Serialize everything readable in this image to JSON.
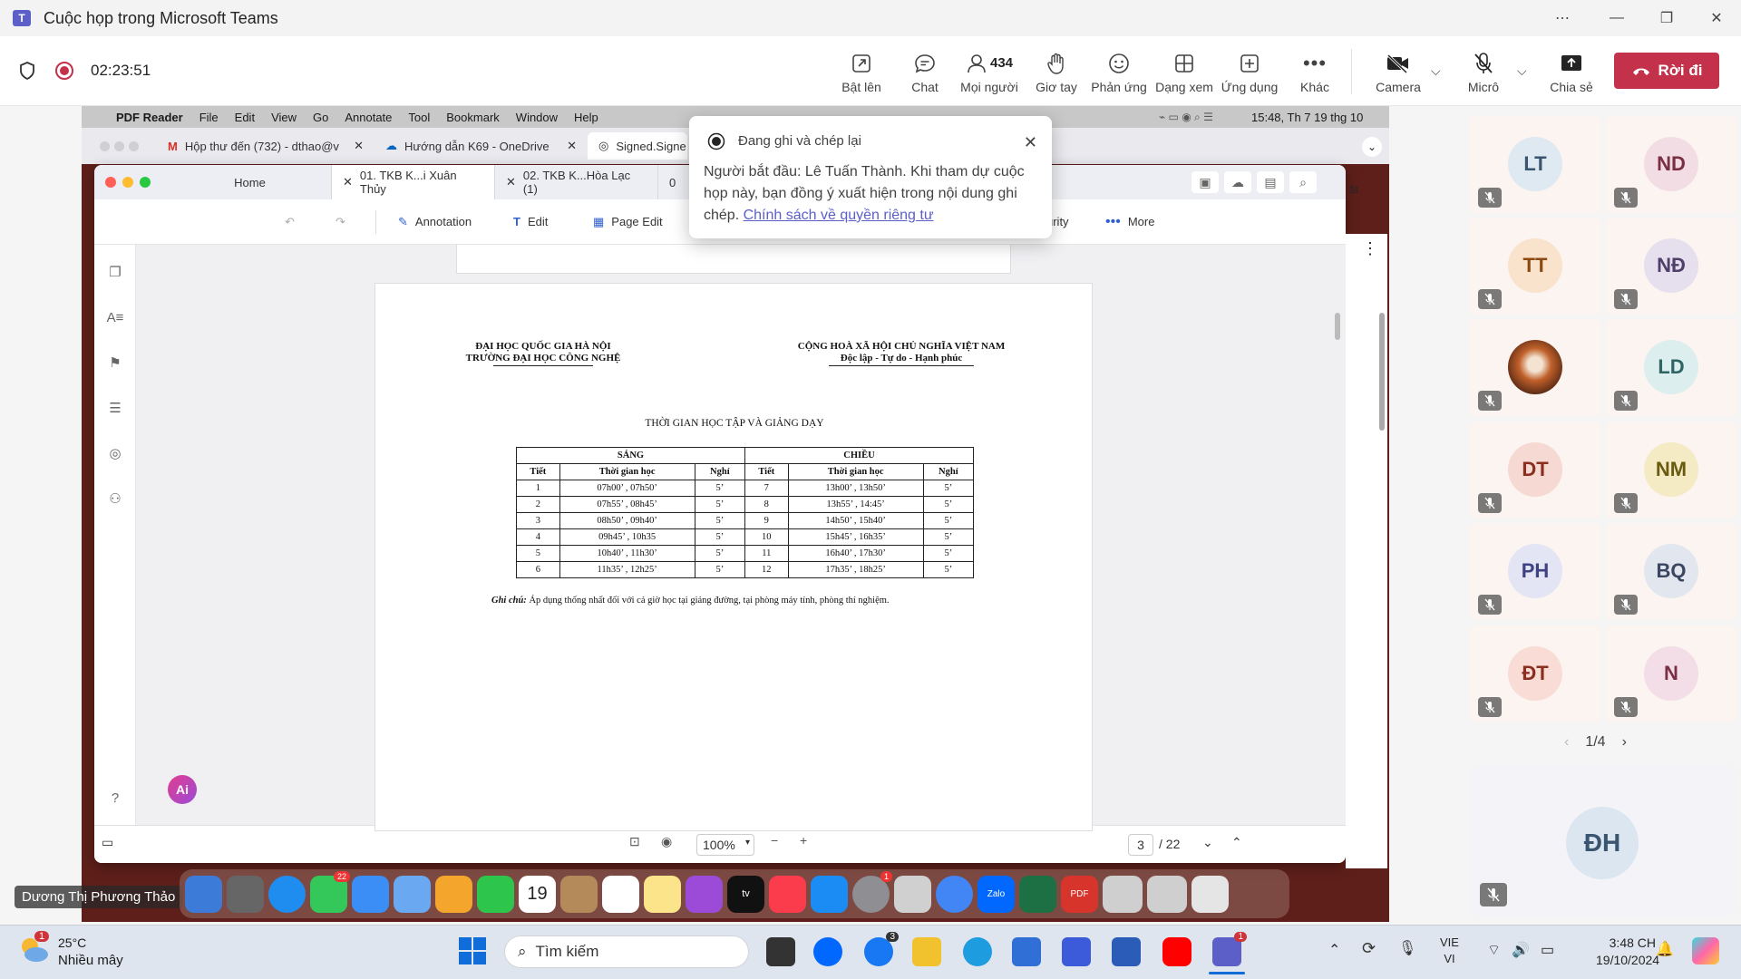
{
  "window": {
    "title": "Cuộc họp trong Microsoft Teams"
  },
  "meeting": {
    "timer": "02:23:51",
    "toolbar": [
      {
        "label": "Bật lên",
        "icon": "pop-out-icon"
      },
      {
        "label": "Chat",
        "icon": "chat-icon"
      },
      {
        "label": "Mọi người",
        "icon": "people-icon",
        "count": "434"
      },
      {
        "label": "Giơ tay",
        "icon": "raise-hand-icon"
      },
      {
        "label": "Phản ứng",
        "icon": "reactions-icon"
      },
      {
        "label": "Dạng xem",
        "icon": "view-icon"
      },
      {
        "label": "Ứng dụng",
        "icon": "apps-icon"
      },
      {
        "label": "Khác",
        "icon": "more-icon"
      },
      {
        "label": "Camera",
        "icon": "camera-off-icon"
      },
      {
        "label": "Micrô",
        "icon": "mic-off-icon"
      },
      {
        "label": "Chia sẻ",
        "icon": "share-icon"
      }
    ],
    "leave_label": "Rời đi"
  },
  "recording_popup": {
    "title": "Đang ghi và chép lại",
    "body": "Người bắt đầu: Lê Tuấn Thành. Khi tham dự cuộc họp này, bạn đồng ý xuất hiện trong nội dung ghi chép.",
    "link": "Chính sách về quyền riêng tư"
  },
  "mac": {
    "menu": [
      "PDF Reader",
      "File",
      "Edit",
      "View",
      "Go",
      "Annotate",
      "Tool",
      "Bookmark",
      "Window",
      "Help"
    ],
    "clock": "15:48, Th 7 19 thg 10",
    "browser_tabs": [
      "Hộp thư đến (732) - dthao@v",
      "Hướng dẫn K69 - OneDrive",
      "Signed.Signe"
    ],
    "dock_date": "19",
    "dock_badges": {
      "messages": "22",
      "settings": "1"
    },
    "presenter": "Dương Thị Phương Thảo"
  },
  "pdf": {
    "tabs": [
      "Home",
      "01. TKB K...i Xuân Thủy",
      "02. TKB K...Hòa Lạc (1)",
      "0"
    ],
    "toolbar": {
      "annotation": "Annotation",
      "edit": "Edit",
      "page_edit": "Page Edit",
      "security_partial": "urity",
      "more": "More",
      "search_partial": "ật"
    },
    "zoom": "100%",
    "page_current": "3",
    "page_total": "/ 22",
    "ai_badge": "Ai"
  },
  "document": {
    "left_header": [
      "ĐẠI HỌC QUỐC GIA HÀ NỘI",
      "TRƯỜNG ĐẠI HỌC CÔNG NGHỆ"
    ],
    "right_header": [
      "CỘNG HOÀ XÃ HỘI CHỦ NGHĨA VIỆT NAM",
      "Độc lập - Tự do - Hạnh phúc"
    ],
    "title": "THỜI GIAN HỌC TẬP VÀ GIẢNG DẠY",
    "group_headers": [
      "SÁNG",
      "CHIỀU"
    ],
    "columns": [
      "Tiết",
      "Thời gian học",
      "Nghỉ",
      "Tiết",
      "Thời gian học",
      "Nghỉ"
    ],
    "rows": [
      [
        "1",
        "07h00’ , 07h50’",
        "5’",
        "7",
        "13h00’ , 13h50’",
        "5’"
      ],
      [
        "2",
        "07h55’ , 08h45’",
        "5’",
        "8",
        "13h55’ , 14:45’",
        "5’"
      ],
      [
        "3",
        "08h50’ , 09h40’",
        "5’",
        "9",
        "14h50’ , 15h40’",
        "5’"
      ],
      [
        "4",
        "09h45’ , 10h35",
        "5’",
        "10",
        "15h45’ , 16h35’",
        "5’"
      ],
      [
        "5",
        "10h40’ , 11h30’",
        "5’",
        "11",
        "16h40’ , 17h30’",
        "5’"
      ],
      [
        "6",
        "11h35’ , 12h25’",
        "5’",
        "12",
        "17h35’ , 18h25’",
        "5’"
      ]
    ],
    "note_label": "Ghi chú:",
    "note": "Áp dụng thống nhất đối với cả giờ học tại giảng đường, tại phòng máy tính, phòng thí nghiệm."
  },
  "participants": {
    "tiles": [
      {
        "initials": "LT",
        "bg": "#dfe9f1",
        "fg": "#3a5570"
      },
      {
        "initials": "ND",
        "bg": "#f2dde5",
        "fg": "#7a2f45"
      },
      {
        "initials": "TT",
        "bg": "#fae3cc",
        "fg": "#8a4a12"
      },
      {
        "initials": "NĐ",
        "bg": "#e6e0ee",
        "fg": "#4f3f6b"
      },
      {
        "initials": "",
        "bg": "#a0552a",
        "fg": "#fff"
      },
      {
        "initials": "LD",
        "bg": "#dceeee",
        "fg": "#2e6464"
      },
      {
        "initials": "DT",
        "bg": "#f6d9d2",
        "fg": "#8a2e1f"
      },
      {
        "initials": "NM",
        "bg": "#f4ebc5",
        "fg": "#6a5a10"
      },
      {
        "initials": "PH",
        "bg": "#e3e4f4",
        "fg": "#3f4280"
      },
      {
        "initials": "BQ",
        "bg": "#e2e6ee",
        "fg": "#3b4760"
      },
      {
        "initials": "ĐT",
        "bg": "#f9dcd5",
        "fg": "#8a2e1f"
      },
      {
        "initials": "N",
        "bg": "#f3dde6",
        "fg": "#7a2f45"
      }
    ],
    "pager": "1/4",
    "self": {
      "initials": "ĐH",
      "bg": "#dbe6f1",
      "fg": "#3a5570"
    }
  },
  "taskbar": {
    "weather_temp": "25°C",
    "weather_desc": "Nhiều mây",
    "weather_badge": "1",
    "search": "Tìm kiếm",
    "lang": "VIE",
    "lang2": "VI",
    "time": "3:48 CH",
    "date": "19/10/2024",
    "badges": {
      "app": "3",
      "teams": "1"
    }
  }
}
